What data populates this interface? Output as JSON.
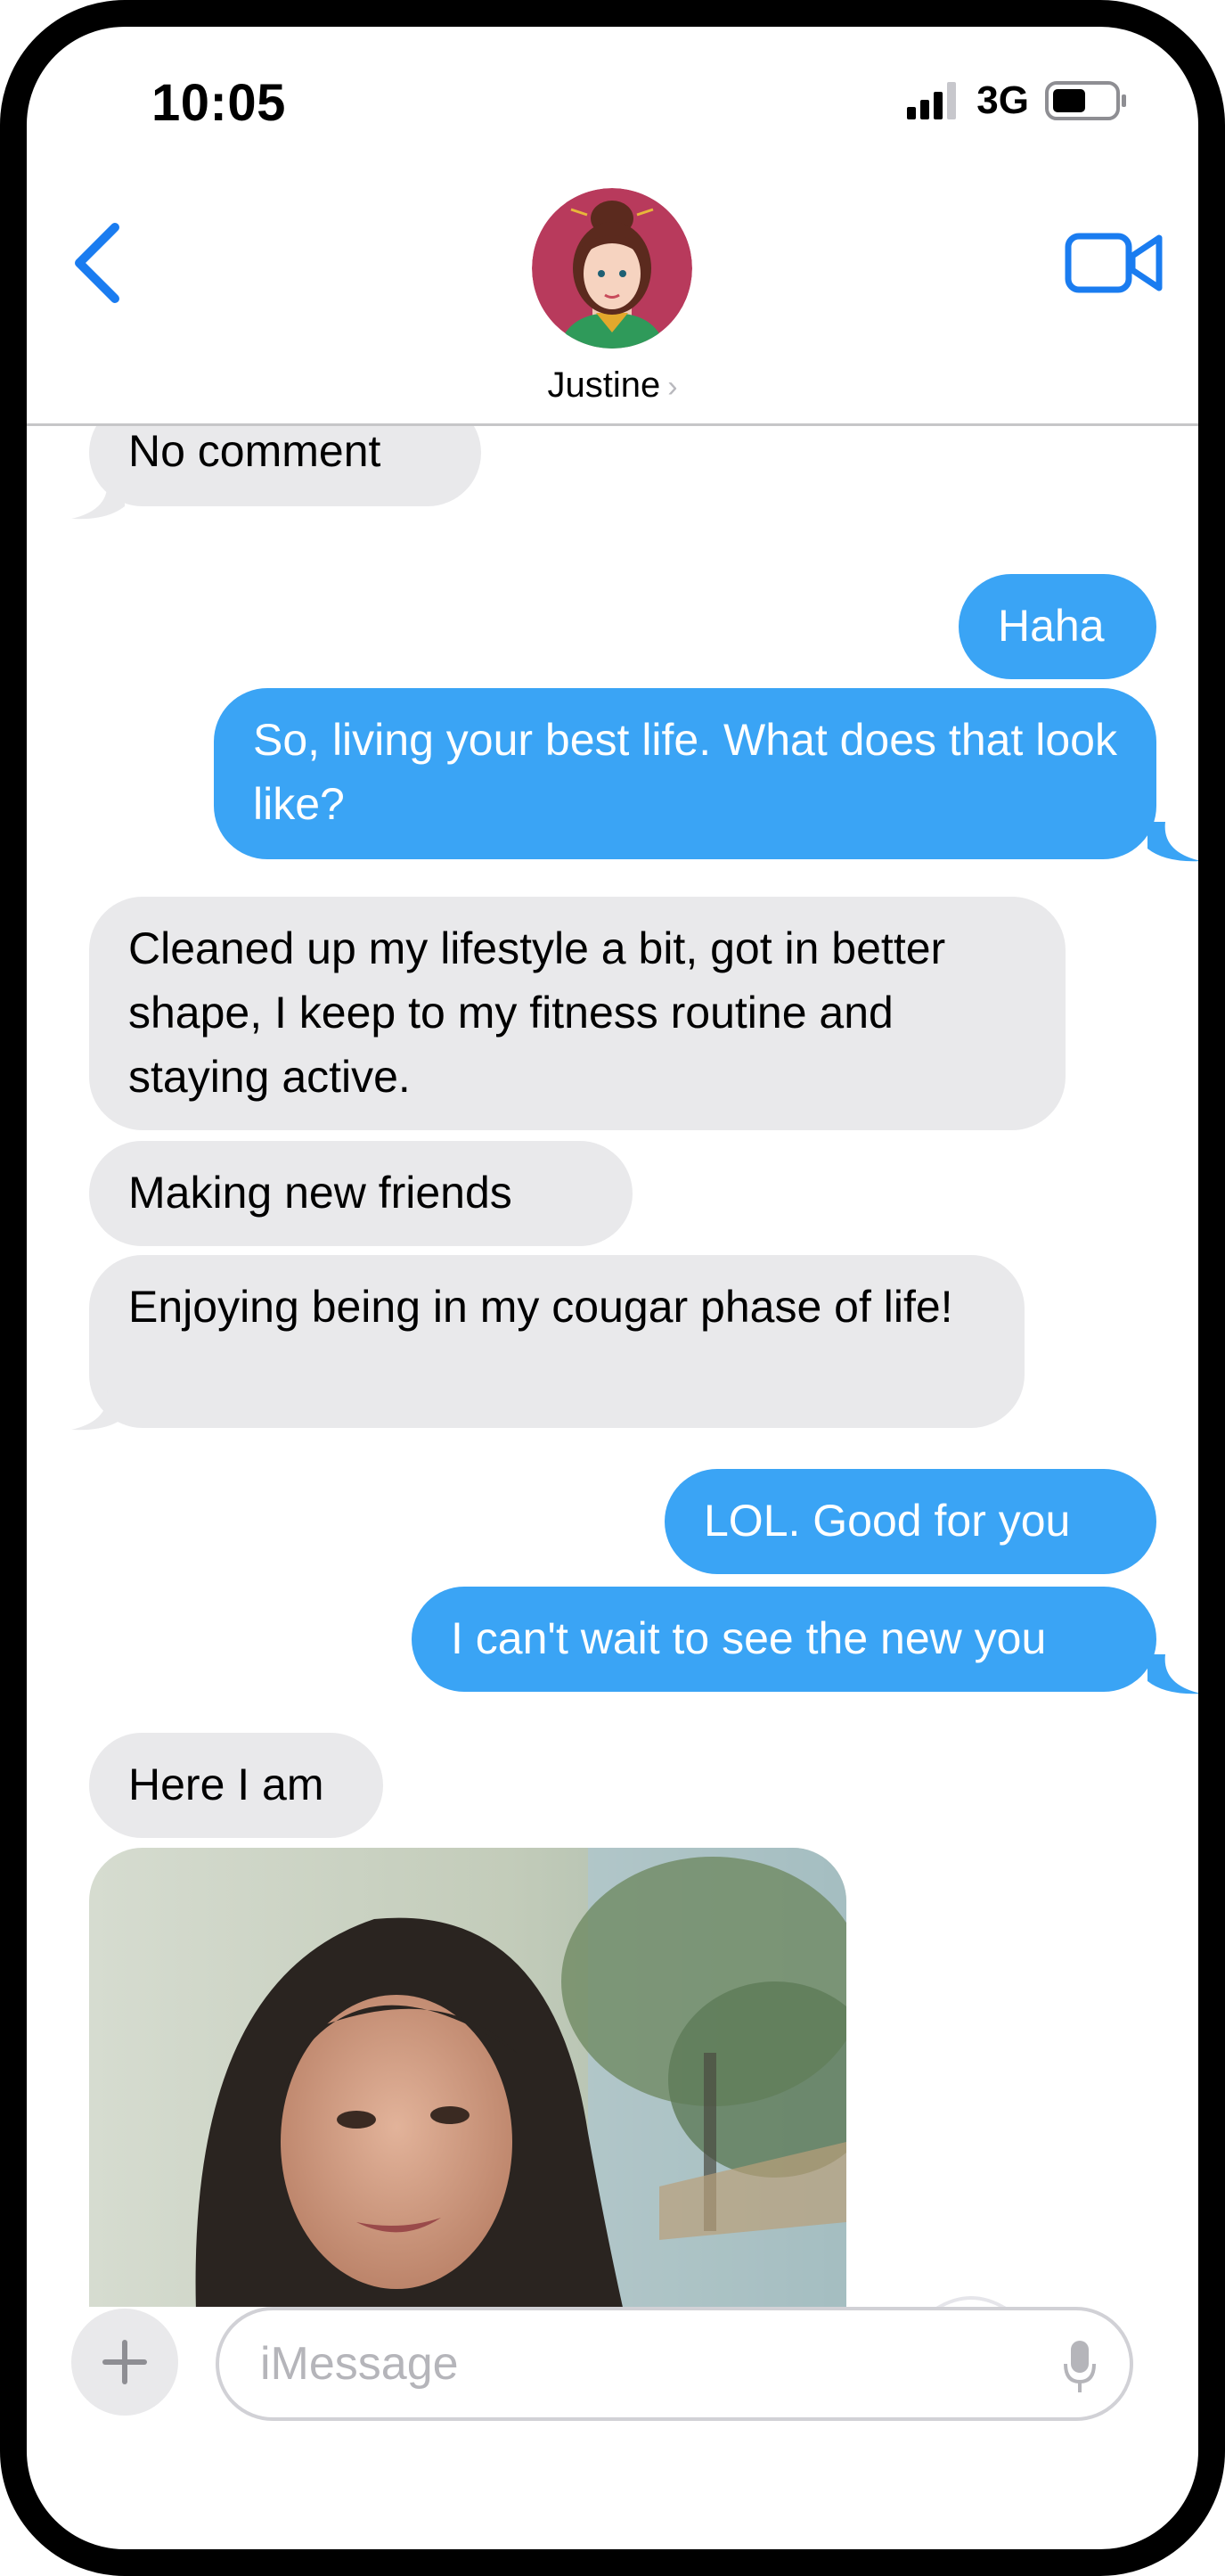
{
  "status": {
    "time": "10:05",
    "network": "3G"
  },
  "header": {
    "contact_name": "Justine",
    "chevron": "›",
    "back_icon": "chevron-left-icon",
    "video_icon": "video-camera-icon"
  },
  "messages": [
    {
      "dir": "in",
      "text": "No comment"
    },
    {
      "dir": "out",
      "text": "Haha"
    },
    {
      "dir": "out",
      "text": "So, living your best life.  What does that look like?"
    },
    {
      "dir": "in",
      "text": "Cleaned up my lifestyle a bit, got in better shape, I keep to my fitness routine and staying active."
    },
    {
      "dir": "in",
      "text": "Making new friends"
    },
    {
      "dir": "in",
      "text": "Enjoying being in my cougar phase of life!"
    },
    {
      "dir": "out",
      "text": "LOL.  Good for you"
    },
    {
      "dir": "out",
      "text": "I can't wait to see the new you"
    },
    {
      "dir": "in",
      "text": "Here I am"
    }
  ],
  "composer": {
    "placeholder": "iMessage"
  },
  "colors": {
    "accent": "#1a7cf0",
    "outgoing": "#3aa4f5",
    "incoming": "#e9e9eb"
  }
}
